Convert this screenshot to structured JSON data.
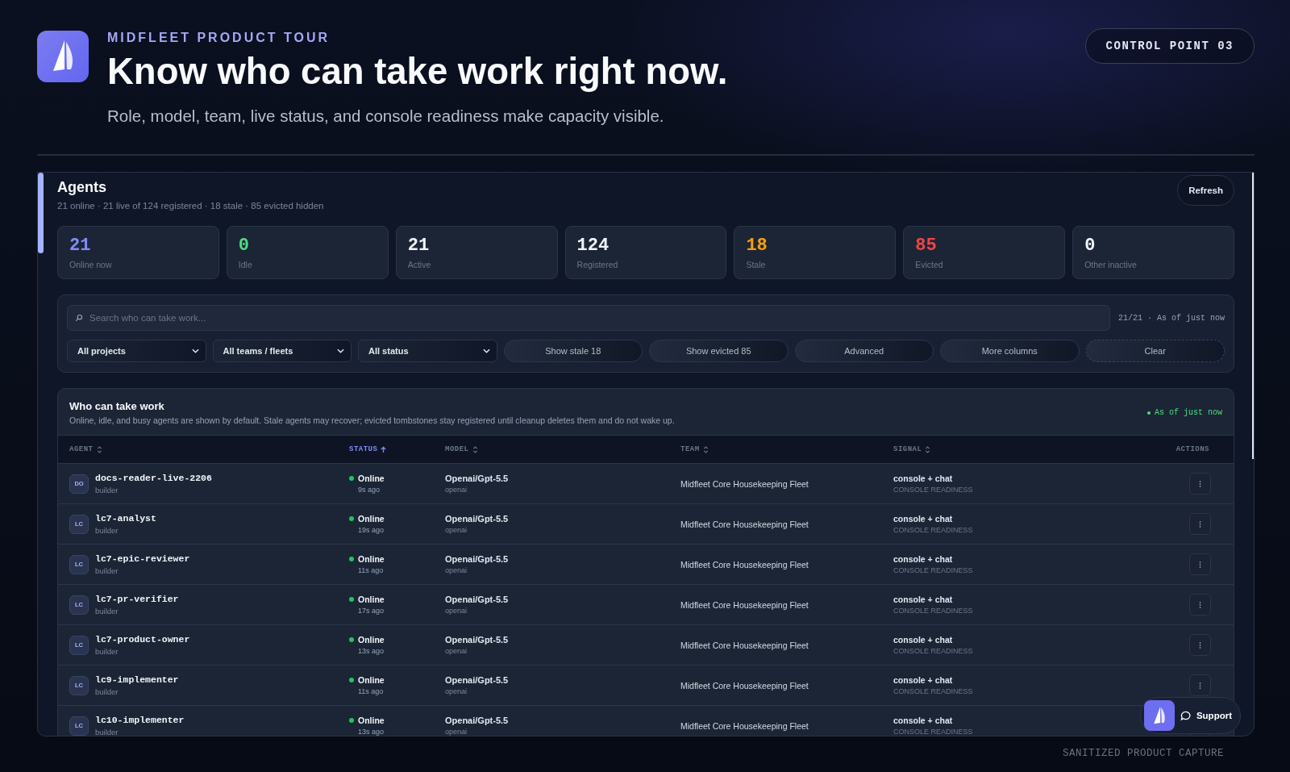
{
  "header": {
    "eyebrow": "MIDFLEET PRODUCT TOUR",
    "title": "Know who can take work right now.",
    "subtitle": "Role, model, team, live status, and console readiness make capacity visible.",
    "badge": "CONTROL POINT 03"
  },
  "panel": {
    "title": "Agents",
    "summary": "21 online · 21 live of 124 registered · 18 stale · 85 evicted hidden",
    "refresh": "Refresh"
  },
  "stats": [
    {
      "value": "21",
      "label": "Online now",
      "color": "#818cf8"
    },
    {
      "value": "0",
      "label": "Idle",
      "color": "#4ade80"
    },
    {
      "value": "21",
      "label": "Active",
      "color": "#f1f5f9"
    },
    {
      "value": "124",
      "label": "Registered",
      "color": "#f1f5f9"
    },
    {
      "value": "18",
      "label": "Stale",
      "color": "#f59e0b"
    },
    {
      "value": "85",
      "label": "Evicted",
      "color": "#ef4444"
    },
    {
      "value": "0",
      "label": "Other inactive",
      "color": "#f1f5f9"
    }
  ],
  "filters": {
    "search_placeholder": "Search who can take work...",
    "count": "21/21 · As of just now",
    "selects": [
      "All projects",
      "All teams / fleets",
      "All status"
    ],
    "buttons": [
      {
        "label": "Show stale 18",
        "kind": "pill"
      },
      {
        "label": "Show evicted 85",
        "kind": "pill"
      },
      {
        "label": "Advanced",
        "kind": "pill"
      },
      {
        "label": "More columns",
        "kind": "pill"
      },
      {
        "label": "Clear",
        "kind": "dashed"
      }
    ]
  },
  "table": {
    "title": "Who can take work",
    "description": "Online, idle, and busy agents are shown by default. Stale agents may recover; evicted tombstones stay registered until cleanup deletes them and do not wake up.",
    "freshness": "As of just now",
    "columns": [
      {
        "label": "AGENT",
        "sortable": true,
        "sorted": false
      },
      {
        "label": "STATUS",
        "sortable": true,
        "sorted": true
      },
      {
        "label": "MODEL",
        "sortable": true,
        "sorted": false
      },
      {
        "label": "TEAM",
        "sortable": true,
        "sorted": false
      },
      {
        "label": "SIGNAL",
        "sortable": true,
        "sorted": false
      },
      {
        "label": "ACTIONS",
        "sortable": false,
        "sorted": false
      }
    ],
    "rows": [
      {
        "initials": "DO",
        "name": "docs-reader-live-2206",
        "role": "builder",
        "status": "Online",
        "online": true,
        "seen": "9s ago",
        "model": "Openai/Gpt-5.5",
        "provider": "openai",
        "team": "Midfleet Core Housekeeping Fleet",
        "signal": "console + chat",
        "signal_note": "CONSOLE READINESS"
      },
      {
        "initials": "LC",
        "name": "lc7-analyst",
        "role": "builder",
        "status": "Online",
        "online": true,
        "seen": "19s ago",
        "model": "Openai/Gpt-5.5",
        "provider": "openai",
        "team": "Midfleet Core Housekeeping Fleet",
        "signal": "console + chat",
        "signal_note": "CONSOLE READINESS"
      },
      {
        "initials": "LC",
        "name": "lc7-epic-reviewer",
        "role": "builder",
        "status": "Online",
        "online": true,
        "seen": "11s ago",
        "model": "Openai/Gpt-5.5",
        "provider": "openai",
        "team": "Midfleet Core Housekeeping Fleet",
        "signal": "console + chat",
        "signal_note": "CONSOLE READINESS"
      },
      {
        "initials": "LC",
        "name": "lc7-pr-verifier",
        "role": "builder",
        "status": "Online",
        "online": true,
        "seen": "17s ago",
        "model": "Openai/Gpt-5.5",
        "provider": "openai",
        "team": "Midfleet Core Housekeeping Fleet",
        "signal": "console + chat",
        "signal_note": "CONSOLE READINESS"
      },
      {
        "initials": "LC",
        "name": "lc7-product-owner",
        "role": "builder",
        "status": "Online",
        "online": true,
        "seen": "13s ago",
        "model": "Openai/Gpt-5.5",
        "provider": "openai",
        "team": "Midfleet Core Housekeeping Fleet",
        "signal": "console + chat",
        "signal_note": "CONSOLE READINESS"
      },
      {
        "initials": "LC",
        "name": "lc9-implementer",
        "role": "builder",
        "status": "Online",
        "online": true,
        "seen": "11s ago",
        "model": "Openai/Gpt-5.5",
        "provider": "openai",
        "team": "Midfleet Core Housekeeping Fleet",
        "signal": "console + chat",
        "signal_note": "CONSOLE READINESS"
      },
      {
        "initials": "LC",
        "name": "lc10-implementer",
        "role": "builder",
        "status": "Online",
        "online": true,
        "seen": "13s ago",
        "model": "Openai/Gpt-5.5",
        "provider": "openai",
        "team": "Midfleet Core Housekeeping Fleet",
        "signal": "console + chat",
        "signal_note": "CONSOLE READINESS"
      }
    ]
  },
  "support": {
    "label": "Support"
  },
  "footer": "SANITIZED PRODUCT CAPTURE"
}
